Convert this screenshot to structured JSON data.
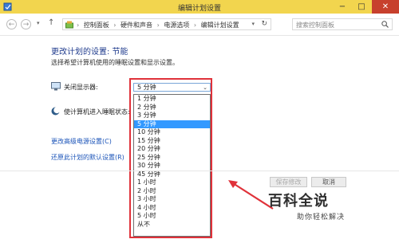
{
  "window": {
    "title": "编辑计划设置",
    "min_glyph": "−",
    "max_glyph": "□",
    "close_glyph": "✕"
  },
  "nav": {
    "back_glyph": "←",
    "forward_glyph": "→",
    "dropdown_glyph": "▾",
    "up_glyph": "↑",
    "breadcrumbs": [
      "控制面板",
      "硬件和声音",
      "电源选项",
      "编辑计划设置"
    ],
    "breadcrumb_sep": "›",
    "refresh_glyph": "↻",
    "search_placeholder": "搜索控制面板"
  },
  "main": {
    "heading": "更改计划的设置: 节能",
    "subtext": "选择希望计算机使用的睡眠设置和显示设置。",
    "display_label": "关闭显示器:",
    "sleep_label": "使计算机进入睡眠状态:",
    "display_select": {
      "value": "5 分钟",
      "arrow": "⌄"
    },
    "options": [
      "1 分钟",
      "2 分钟",
      "3 分钟",
      "5 分钟",
      "10 分钟",
      "15 分钟",
      "20 分钟",
      "25 分钟",
      "30 分钟",
      "45 分钟",
      "1 小时",
      "2 小时",
      "3 小时",
      "4 小时",
      "5 小时",
      "从不"
    ],
    "selected_option": "5 分钟",
    "link_advanced": "更改高级电源设置(C)",
    "link_restore": "还原此计划的默认设置(R)"
  },
  "footer": {
    "save_label": "保存修改",
    "cancel_label": "取消"
  },
  "watermark": {
    "title": "百科全说",
    "subtitle": "助你轻松解决"
  },
  "colors": {
    "titlebar": "#f2d54e",
    "close": "#c7402d",
    "highlight": "#e0323a",
    "link": "#1a53b8",
    "selected": "#3399ff"
  }
}
